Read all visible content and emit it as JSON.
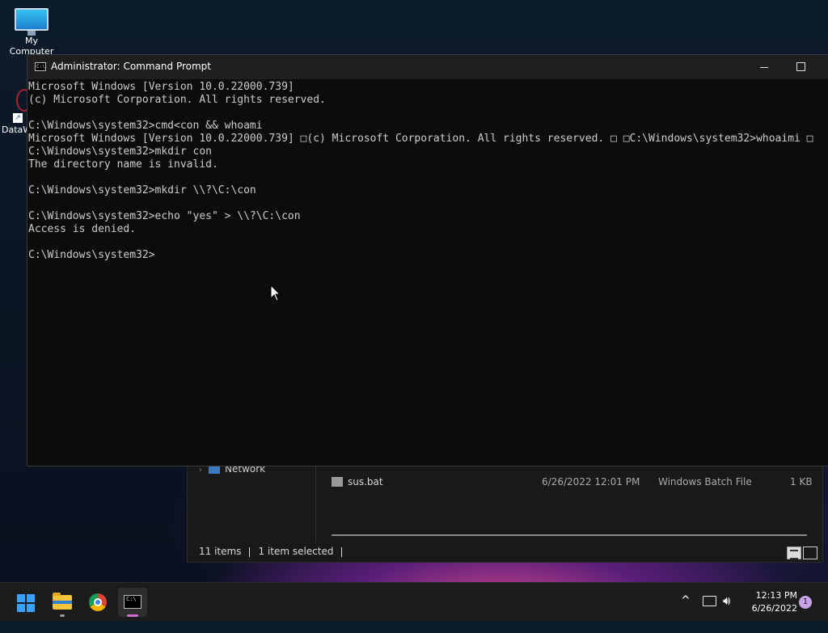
{
  "desktop": {
    "icons": [
      {
        "label": "My Computer"
      },
      {
        "label": "DataW"
      }
    ]
  },
  "cmd_window": {
    "title": "Administrator: Command Prompt",
    "app_icon_text": "C:\\",
    "lines": [
      "Microsoft Windows [Version 10.0.22000.739]",
      "(c) Microsoft Corporation. All rights reserved.",
      "",
      "C:\\Windows\\system32>cmd<con && whoami",
      "Microsoft Windows [Version 10.0.22000.739] □(c) Microsoft Corporation. All rights reserved. □ □C:\\Windows\\system32>whoaimi □",
      "C:\\Windows\\system32>mkdir con",
      "The directory name is invalid.",
      "",
      "C:\\Windows\\system32>mkdir \\\\?\\C:\\con",
      "",
      "C:\\Windows\\system32>echo \"yes\" > \\\\?\\C:\\con",
      "Access is denied.",
      "",
      "C:\\Windows\\system32>"
    ]
  },
  "explorer": {
    "nav_network": "Network",
    "file": {
      "name": "sus.bat",
      "date": "6/26/2022 12:01 PM",
      "type": "Windows Batch File",
      "size": "1 KB"
    },
    "status": {
      "items": "11 items",
      "selected": "1 item selected"
    }
  },
  "taskbar": {
    "apps": [
      {
        "name": "start",
        "icon": "windows-logo-icon"
      },
      {
        "name": "file-explorer",
        "icon": "folder-icon"
      },
      {
        "name": "chrome",
        "icon": "chrome-icon"
      },
      {
        "name": "command-prompt",
        "icon": "terminal-icon",
        "active": true
      }
    ],
    "tray": {
      "chevron": "^",
      "time": "12:13 PM",
      "date": "6/26/2022",
      "notifications": "1"
    }
  },
  "colors": {
    "console_bg": "#0c0c0c",
    "console_text": "#cccccc",
    "accent_start": "#3aa0ff",
    "active_indicator": "#d56dd0"
  }
}
